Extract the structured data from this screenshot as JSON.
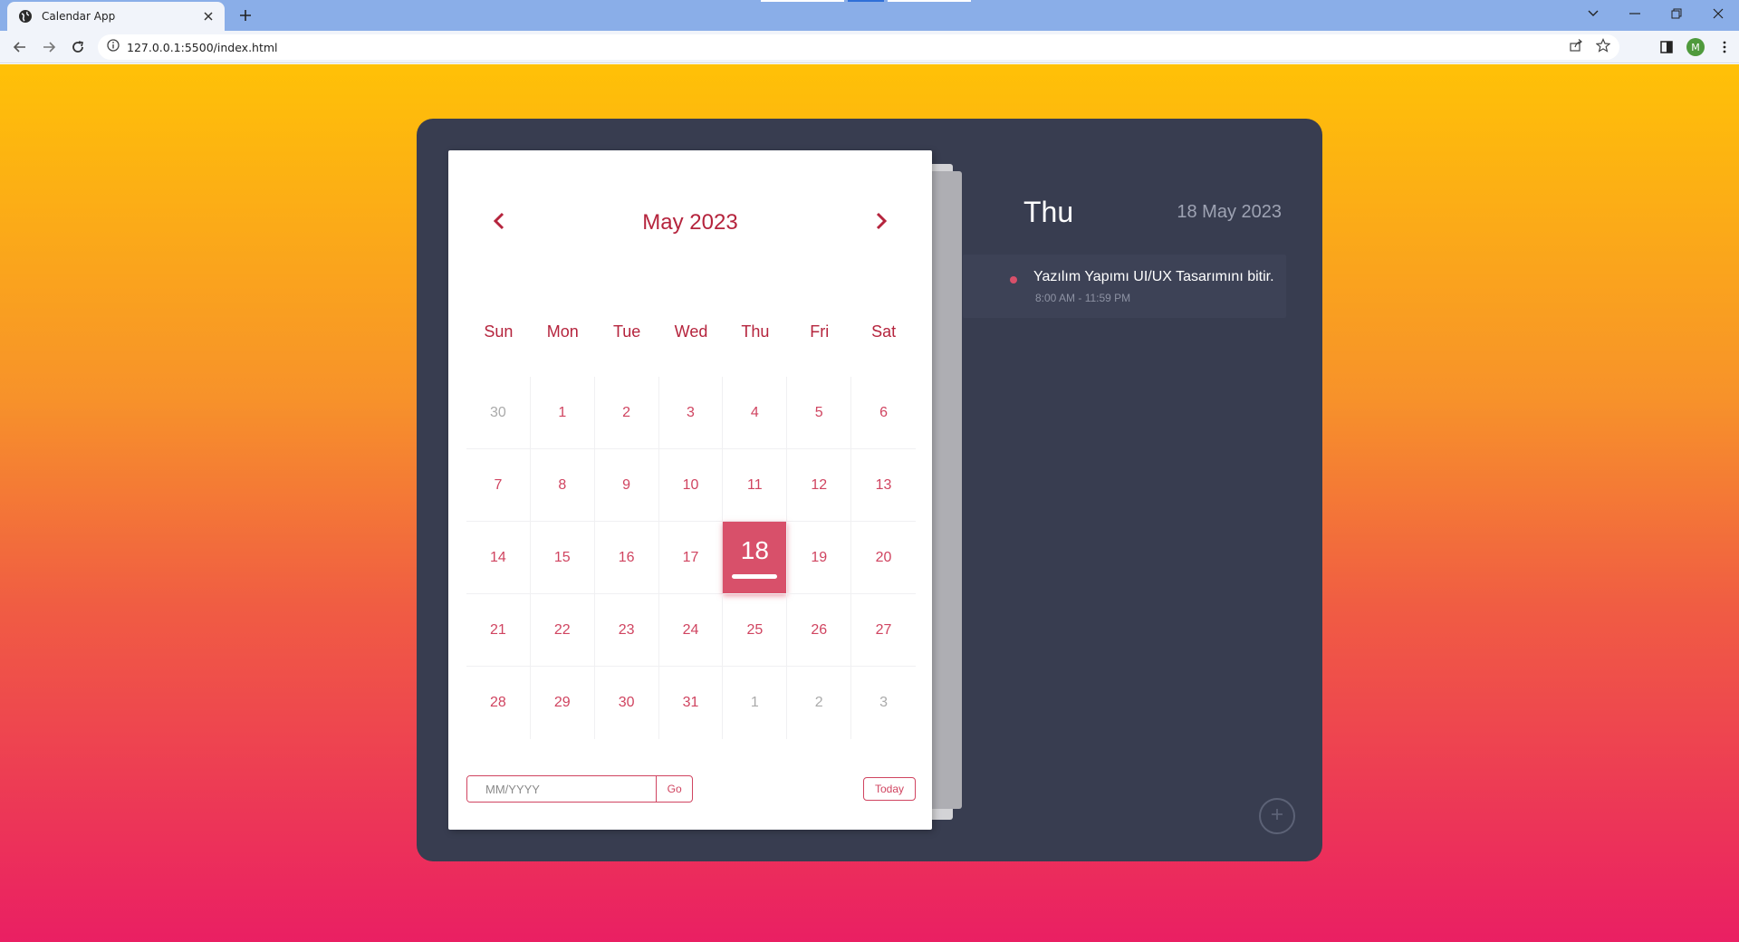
{
  "browser": {
    "tab_title": "Calendar App",
    "url": "127.0.0.1:5500/index.html",
    "profile_initial": "M"
  },
  "calendar": {
    "month_title": "May 2023",
    "weekdays": [
      "Sun",
      "Mon",
      "Tue",
      "Wed",
      "Thu",
      "Fri",
      "Sat"
    ],
    "days": [
      {
        "label": "30",
        "other": true
      },
      {
        "label": "1"
      },
      {
        "label": "2"
      },
      {
        "label": "3"
      },
      {
        "label": "4"
      },
      {
        "label": "5"
      },
      {
        "label": "6"
      },
      {
        "label": "7"
      },
      {
        "label": "8"
      },
      {
        "label": "9"
      },
      {
        "label": "10"
      },
      {
        "label": "11"
      },
      {
        "label": "12"
      },
      {
        "label": "13"
      },
      {
        "label": "14"
      },
      {
        "label": "15"
      },
      {
        "label": "16"
      },
      {
        "label": "17"
      },
      {
        "label": "18",
        "active": true
      },
      {
        "label": "19"
      },
      {
        "label": "20"
      },
      {
        "label": "21"
      },
      {
        "label": "22"
      },
      {
        "label": "23"
      },
      {
        "label": "24"
      },
      {
        "label": "25"
      },
      {
        "label": "26"
      },
      {
        "label": "27"
      },
      {
        "label": "28"
      },
      {
        "label": "29"
      },
      {
        "label": "30"
      },
      {
        "label": "31"
      },
      {
        "label": "1",
        "other": true
      },
      {
        "label": "2",
        "other": true
      },
      {
        "label": "3",
        "other": true
      }
    ],
    "goto_placeholder": "MM/YYYY",
    "go_label": "Go",
    "today_label": "Today"
  },
  "events_panel": {
    "day_name": "Thu",
    "date": "18 May 2023",
    "events": [
      {
        "title": "Yazılım Yapımı UI/UX Tasarımını bitir.",
        "time": "8:00 AM - 11:59 PM"
      }
    ]
  },
  "colors": {
    "accent": "#d8506a",
    "month_title": "#b5243d",
    "panel_bg": "#383d50"
  }
}
